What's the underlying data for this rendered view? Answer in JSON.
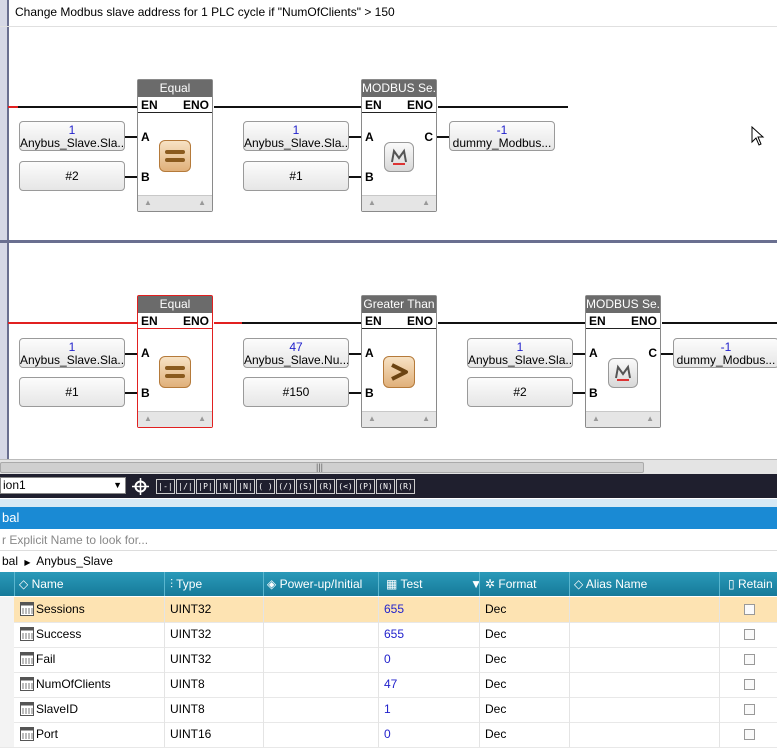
{
  "rung1": {
    "comment": "Change Modbus slave address for 1 PLC cycle if \"NumOfClients\" > 150",
    "blocks": [
      {
        "title": "Equal",
        "en": "EN",
        "eno": "ENO",
        "pin_a": "A",
        "pin_b": "B",
        "icon": "equal-icon"
      },
      {
        "title": "MODBUS Se...",
        "en": "EN",
        "eno": "ENO",
        "pin_a": "A",
        "pin_b": "B",
        "pin_c": "C",
        "icon": "modbus-icon"
      }
    ],
    "vars": [
      {
        "value": "1",
        "name": "Anybus_Slave.Sla..."
      },
      {
        "value": "",
        "name": "#2"
      },
      {
        "value": "1",
        "name": "Anybus_Slave.Sla..."
      },
      {
        "value": "",
        "name": "#1"
      },
      {
        "value": "-1",
        "name": "dummy_Modbus..."
      }
    ]
  },
  "rung2": {
    "blocks": [
      {
        "title": "Equal",
        "en": "EN",
        "eno": "ENO",
        "pin_a": "A",
        "pin_b": "B",
        "icon": "equal-icon"
      },
      {
        "title": "Greater Than",
        "en": "EN",
        "eno": "ENO",
        "pin_a": "A",
        "pin_b": "B",
        "icon": "greater-than-icon"
      },
      {
        "title": "MODBUS Se...",
        "en": "EN",
        "eno": "ENO",
        "pin_a": "A",
        "pin_b": "B",
        "pin_c": "C",
        "icon": "modbus-icon"
      }
    ],
    "vars": [
      {
        "value": "1",
        "name": "Anybus_Slave.Sla..."
      },
      {
        "value": "",
        "name": "#1"
      },
      {
        "value": "47",
        "name": "Anybus_Slave.Nu..."
      },
      {
        "value": "",
        "name": "#150"
      },
      {
        "value": "1",
        "name": "Anybus_Slave.Sla..."
      },
      {
        "value": "",
        "name": "#2"
      },
      {
        "value": "-1",
        "name": "dummy_Modbus..."
      }
    ]
  },
  "toolbar": {
    "combo_value": "ion1",
    "buttons": [
      "|-|",
      "|/|",
      "|P|",
      "|N|",
      "|N|",
      "( )",
      "(/)",
      "(S)",
      "(R)",
      "(<)",
      "(P)",
      "(N)",
      "(R)"
    ]
  },
  "panel": {
    "title": "bal",
    "search_placeholder": "r Explicit Name to look for...",
    "breadcrumb_root": "bal",
    "breadcrumb_child": "Anybus_Slave"
  },
  "grid": {
    "headers": {
      "name": "Name",
      "type": "Type",
      "power": "Power-up/Initial",
      "test": "Test",
      "format": "Format",
      "alias": "Alias Name",
      "retain": "Retain"
    },
    "rows": [
      {
        "name": "Sessions",
        "type": "UINT32",
        "test": "655",
        "format": "Dec"
      },
      {
        "name": "Success",
        "type": "UINT32",
        "test": "655",
        "format": "Dec"
      },
      {
        "name": "Fail",
        "type": "UINT32",
        "test": "0",
        "format": "Dec"
      },
      {
        "name": "NumOfClients",
        "type": "UINT8",
        "test": "47",
        "format": "Dec"
      },
      {
        "name": "SlaveID",
        "type": "UINT8",
        "test": "1",
        "format": "Dec"
      },
      {
        "name": "Port",
        "type": "UINT16",
        "test": "0",
        "format": "Dec"
      }
    ]
  },
  "colors": {
    "accent": "#1a8ad4",
    "grid_header": "#1f8aab",
    "selected_row": "#fde3b2",
    "active_wire": "#e12020",
    "value_text": "#2222cc"
  }
}
